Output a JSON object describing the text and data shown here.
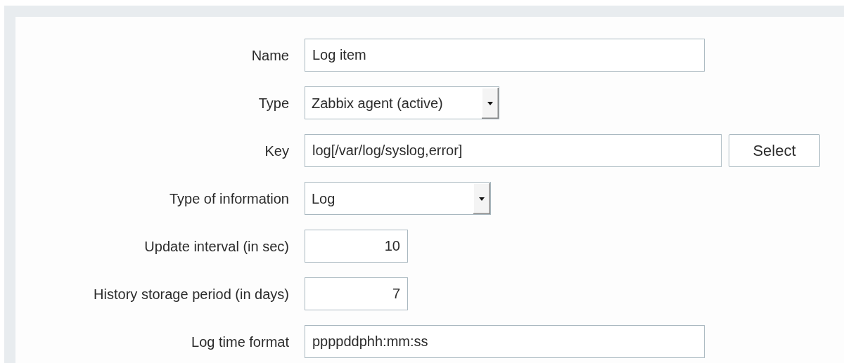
{
  "form": {
    "fields": [
      {
        "label": "Name",
        "kind": "text",
        "value": "Log item"
      },
      {
        "label": "Type",
        "kind": "select",
        "value": "Zabbix agent (active)"
      },
      {
        "label": "Key",
        "kind": "text",
        "value": "log[/var/log/syslog,error]",
        "button": "Select"
      },
      {
        "label": "Type of information",
        "kind": "select",
        "value": "Log"
      },
      {
        "label": "Update interval (in sec)",
        "kind": "number",
        "value": "10"
      },
      {
        "label": "History storage period (in days)",
        "kind": "number",
        "value": "7"
      },
      {
        "label": "Log time format",
        "kind": "text",
        "value": "ppppddphh:mm:ss"
      }
    ]
  }
}
